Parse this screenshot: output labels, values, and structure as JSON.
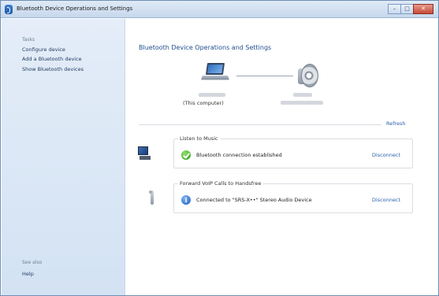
{
  "window": {
    "title": "Bluetooth Device Operations and Settings",
    "controls": {
      "minimize": "–",
      "maximize": "□",
      "close": "✕"
    }
  },
  "sidebar": {
    "tasks_heading": "Tasks",
    "items": [
      {
        "label": "Configure device"
      },
      {
        "label": "Add a Bluetooth device"
      },
      {
        "label": "Show Bluetooth devices"
      }
    ],
    "see_also_heading": "See also",
    "help_label": "Help"
  },
  "main": {
    "title": "Bluetooth Device Operations and Settings",
    "computer_caption": "(This computer)",
    "refresh_label": "Refresh",
    "services": [
      {
        "group_label": "Listen to Music",
        "status_icon": "checkmark-icon",
        "status_text": "Bluetooth connection established",
        "action_label": "Disconnect"
      },
      {
        "group_label": "Forward VoIP Calls to Handsfree",
        "status_icon": "info-icon",
        "status_text": "Connected to \"SRS-X••\" Stereo Audio Device",
        "action_label": "Disconnect"
      }
    ]
  },
  "colors": {
    "accent": "#1f4f8f",
    "link": "#2c62a8",
    "sidebar_bg": "#dbe7f5",
    "ok": "#2f9a1c",
    "info": "#1d5fc0"
  }
}
